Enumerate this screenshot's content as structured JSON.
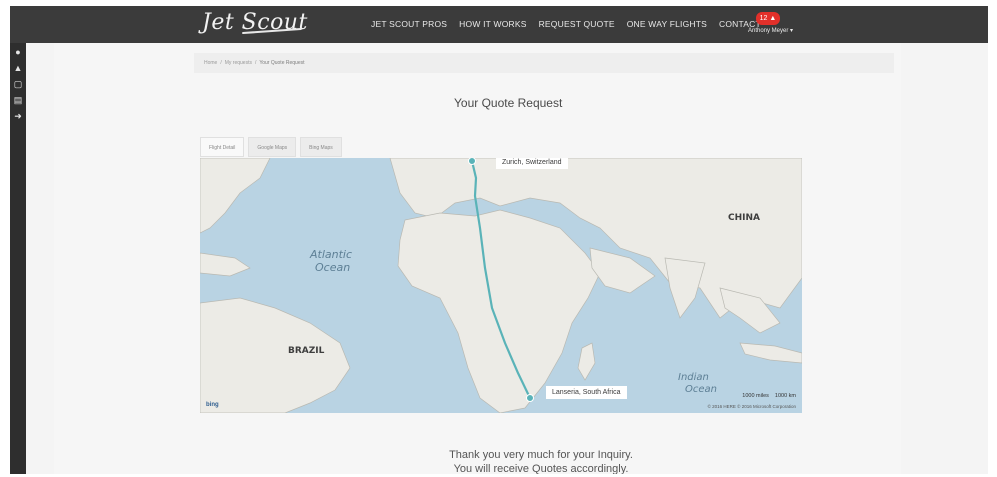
{
  "app": {
    "logo_text": "Jet Scout"
  },
  "nav": {
    "items": [
      "JET SCOUT PROS",
      "HOW IT WORKS",
      "REQUEST QUOTE",
      "ONE WAY FLIGHTS",
      "CONTACT"
    ],
    "notification_count": "12",
    "user_name": "Anthony Meyer ▾"
  },
  "sidebar": {
    "icons": [
      "user-icon",
      "bell-icon",
      "documents-icon",
      "printer-icon",
      "logout-icon"
    ]
  },
  "breadcrumb": {
    "items": [
      "Home",
      "My requests"
    ],
    "current": "Your Quote Request"
  },
  "page": {
    "title": "Your Quote Request",
    "thanks_line1": "Thank you very much for your Inquiry.",
    "thanks_line2": "You will receive Quotes accordingly."
  },
  "map_tabs": [
    "Flight Detail",
    "Google Maps",
    "Bing Maps"
  ],
  "map": {
    "origin_label": "Zurich, Switzerland",
    "destination_label": "Lanseria, South Africa",
    "labels": {
      "ocean_atlantic_1": "Atlantic",
      "ocean_atlantic_2": "Ocean",
      "ocean_indian_1": "Indian",
      "ocean_indian_2": "Ocean",
      "brazil": "BRAZIL",
      "china": "CHINA"
    },
    "scale_miles": "1000 miles",
    "scale_km": "1000 km",
    "credit": "© 2016 HERE  © 2016 Microsoft Corporation",
    "brand": "bing"
  },
  "colors": {
    "topbar": "#3b3b3b",
    "route": "#5ab3b8",
    "water": "#b9d3e3",
    "land": "#ecebe6",
    "badge": "#e2302a"
  }
}
